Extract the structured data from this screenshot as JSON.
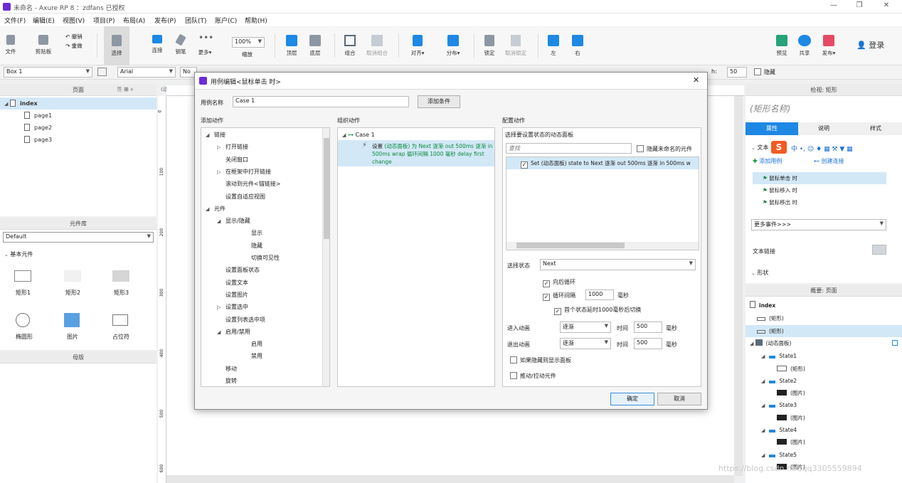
{
  "window": {
    "title": "未命名 - Axure RP 8 ：zdfans 已授权",
    "minimize": "—",
    "maximize": "❐",
    "close": "✕"
  },
  "menu": [
    "文件(F)",
    "编辑(E)",
    "视图(V)",
    "项目(P)",
    "布局(A)",
    "发布(P)",
    "团队(T)",
    "账户(C)",
    "帮助(H)"
  ],
  "toolbar": {
    "file": "文件",
    "clipboard": "剪贴板",
    "undo": "撤销",
    "redo": "重做",
    "select": "选择",
    "connect": "连接",
    "pen": "钢笔",
    "more": "更多▾",
    "zoom_value": "100%",
    "zoom": "缩放",
    "top": "顶层",
    "bottom": "底层",
    "group": "组合",
    "ungroup": "取消组合",
    "align": "对齐▾",
    "distribute": "分布▾",
    "lock": "锁定",
    "unlock": "取消锁定",
    "left": "左",
    "right": "右",
    "preview": "预览",
    "share": "共享",
    "publish": "发布▾",
    "login": "登录"
  },
  "format": {
    "element": "Box 1",
    "font": "Arial",
    "style": "No",
    "h_label": "h:",
    "h_value": "50",
    "hidden": "隐藏"
  },
  "pages": {
    "title": "页面",
    "items": [
      "index",
      "page1",
      "page2",
      "page3"
    ]
  },
  "library": {
    "title": "元件库",
    "selected": "Default",
    "section": "基本元件",
    "items": [
      "矩形1",
      "矩形2",
      "矩形3",
      "椭圆形",
      "图片",
      "占位符"
    ]
  },
  "masters": {
    "title": "母版"
  },
  "canvas": {
    "tab": "(动态面板) /",
    "ruler_h": [
      "0"
    ],
    "ruler_v": [
      "0",
      "100",
      "200",
      "300",
      "400",
      "500",
      "600"
    ]
  },
  "dialog": {
    "title": "用例编辑<鼠标单击 时>",
    "case_name_label": "用例名称",
    "case_name": "Case 1",
    "add_condition": "添加条件",
    "col_add": "添加动作",
    "col_org": "组织动作",
    "col_config": "配置动作",
    "actions": [
      {
        "t": "链接",
        "lvl": 0,
        "exp": "◢"
      },
      {
        "t": "打开链接",
        "lvl": 1,
        "exp": "▷"
      },
      {
        "t": "关闭窗口",
        "lvl": 1,
        "exp": ""
      },
      {
        "t": "在框架中打开链接",
        "lvl": 1,
        "exp": "▷"
      },
      {
        "t": "滚动到元件<锚链接>",
        "lvl": 1,
        "exp": ""
      },
      {
        "t": "设置自适应视图",
        "lvl": 1,
        "exp": ""
      },
      {
        "t": "元件",
        "lvl": 0,
        "exp": "◢"
      },
      {
        "t": "显示/隐藏",
        "lvl": 1,
        "exp": "◢"
      },
      {
        "t": "显示",
        "lvl": 2,
        "exp": ""
      },
      {
        "t": "隐藏",
        "lvl": 2,
        "exp": ""
      },
      {
        "t": "切换可见性",
        "lvl": 2,
        "exp": ""
      },
      {
        "t": "设置面板状态",
        "lvl": 1,
        "exp": ""
      },
      {
        "t": "设置文本",
        "lvl": 1,
        "exp": ""
      },
      {
        "t": "设置图片",
        "lvl": 1,
        "exp": ""
      },
      {
        "t": "设置选中",
        "lvl": 1,
        "exp": "▷"
      },
      {
        "t": "设置列表选中项",
        "lvl": 1,
        "exp": ""
      },
      {
        "t": "启用/禁用",
        "lvl": 1,
        "exp": "◢"
      },
      {
        "t": "启用",
        "lvl": 2,
        "exp": ""
      },
      {
        "t": "禁用",
        "lvl": 2,
        "exp": ""
      },
      {
        "t": "移动",
        "lvl": 1,
        "exp": ""
      },
      {
        "t": "旋转",
        "lvl": 1,
        "exp": ""
      }
    ],
    "org_case": "Case 1",
    "org_action_a": "设置",
    "org_action_b": "(动态面板) 为 Next 逐渐 out 500ms 逐渐 in 500ms wrap 循环间隔 1000 毫秒 delay first change",
    "select_panel_label": "选择要设置状态的动态面板",
    "search_placeholder": "查找",
    "hide_unnamed": "隐藏未命名的元件",
    "panel_row": "Set (动态面板) state to Next 逐渐 out 500ms 逐渐 in 500ms w",
    "state_label": "选择状态",
    "state_value": "Next",
    "loop_back": "向后循环",
    "loop_interval": "循环间隔",
    "interval_value": "1000",
    "ms": "毫秒",
    "first_delay": "首个状态延时1000毫秒后切换",
    "in_anim_label": "进入动画",
    "in_anim": "逐渐",
    "time": "时间",
    "in_time": "500",
    "out_anim_label": "退出动画",
    "out_anim": "逐渐",
    "out_time": "500",
    "show_if_hidden": "如果隐藏则显示面板",
    "push_pull": "推动/拉动元件",
    "ok": "确定",
    "cancel": "取消"
  },
  "inspector": {
    "title": "检视: 矩形",
    "shape_name": "(矩形名称)",
    "tabs": [
      "属性",
      "说明",
      "样式"
    ],
    "section": "文本",
    "add_case": "添加用例",
    "create_link": "创建连接",
    "events": [
      "鼠标单击 时",
      "鼠标移入 时",
      "鼠标移出 时"
    ],
    "more_events": "更多事件>>>",
    "text_link": "文本链接",
    "shape": "形状"
  },
  "outline": {
    "title": "概要: 页面",
    "items": [
      {
        "t": "index",
        "lvl": 0
      },
      {
        "t": "(矩形)",
        "lvl": 1
      },
      {
        "t": "(矩形)",
        "lvl": 1
      },
      {
        "t": "(动态面板)",
        "lvl": 1
      },
      {
        "t": "State1",
        "lvl": 2
      },
      {
        "t": "(矩形)",
        "lvl": 3
      },
      {
        "t": "State2",
        "lvl": 2
      },
      {
        "t": "(图片)",
        "lvl": 3
      },
      {
        "t": "State3",
        "lvl": 2
      },
      {
        "t": "(图片)",
        "lvl": 3
      },
      {
        "t": "State4",
        "lvl": 2
      },
      {
        "t": "(图片)",
        "lvl": 3
      },
      {
        "t": "State5",
        "lvl": 2
      },
      {
        "t": "(图片)",
        "lvl": 3
      }
    ]
  },
  "watermark": "https://blog.csdn.net/qq3305559894"
}
